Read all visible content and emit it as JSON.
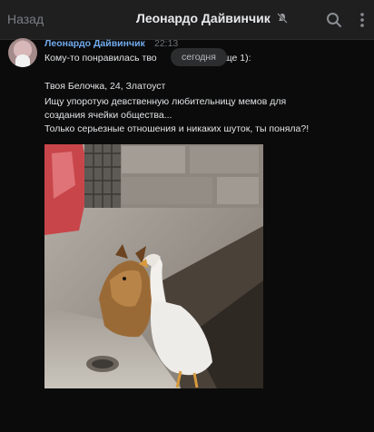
{
  "header": {
    "back_label": "Назад",
    "title": "Леонардо Дайвинчик",
    "icons": {
      "mute": "muted-bell-icon",
      "search": "search-icon",
      "more": "more-vertical-icon"
    }
  },
  "message": {
    "author": "Леонардо Дайвинчик",
    "time": "22:13",
    "date_divider": "сегодня",
    "line1": "Кому-то понравилась тво",
    "line1_tail": "ще 1):",
    "profile_line": "Твоя Белочка, 24, Златоуст",
    "bio_lines": [
      "Ищу упоротую девственную любительницу мемов для",
      "создания ячейки общества...",
      "Только серьезные отношения и никаких шуток, ты поняла?!"
    ],
    "photo": "photo of a goose biting a dog"
  },
  "colors": {
    "header_bg": "#1f1f20",
    "accent": "#71aaeb",
    "text": "#e1e3e6",
    "muted": "#7a7d82"
  }
}
